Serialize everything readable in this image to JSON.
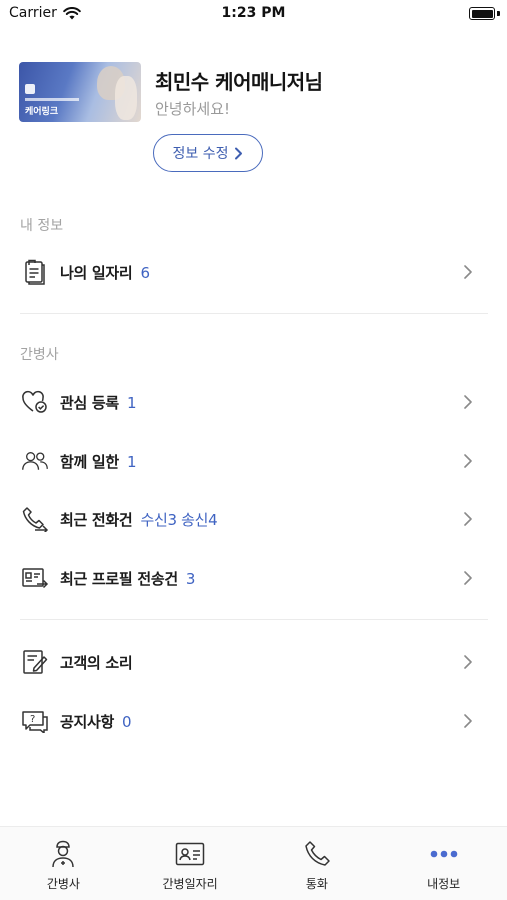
{
  "status_bar": {
    "carrier": "Carrier",
    "time": "1:23 PM"
  },
  "profile": {
    "image_brand": "케어링크",
    "name": "최민수 케어매니저님",
    "greeting": "안녕하세요!",
    "edit_label": "정보 수정"
  },
  "sections": {
    "my_info": {
      "label": "내 정보",
      "items": [
        {
          "label": "나의 일자리",
          "count": "6",
          "icon": "clipboard-icon"
        }
      ]
    },
    "caregiver": {
      "label": "간병사",
      "items": [
        {
          "label": "관심 등록",
          "count": "1",
          "icon": "heart-check-icon"
        },
        {
          "label": "함께 일한",
          "count": "1",
          "icon": "people-icon"
        },
        {
          "label": "최근 전화건",
          "count": "수신3 송신4",
          "icon": "phone-arrow-icon"
        },
        {
          "label": "최근 프로필 전송건",
          "count": "3",
          "icon": "profile-send-icon"
        }
      ]
    },
    "support": {
      "items": [
        {
          "label": "고객의 소리",
          "count": "",
          "icon": "edit-note-icon"
        },
        {
          "label": "공지사항",
          "count": "0",
          "icon": "notice-icon"
        }
      ]
    }
  },
  "tab_bar": {
    "active": "내정보",
    "tabs": [
      {
        "label": "간병사",
        "icon": "nurse-icon"
      },
      {
        "label": "간병일자리",
        "icon": "id-card-icon"
      },
      {
        "label": "통화",
        "icon": "phone-icon"
      },
      {
        "label": "내정보",
        "icon": "more-dots-icon"
      }
    ]
  },
  "colors": {
    "accent": "#3f63c2",
    "muted_text": "#a3a3a3",
    "divider": "#ebebeb"
  }
}
